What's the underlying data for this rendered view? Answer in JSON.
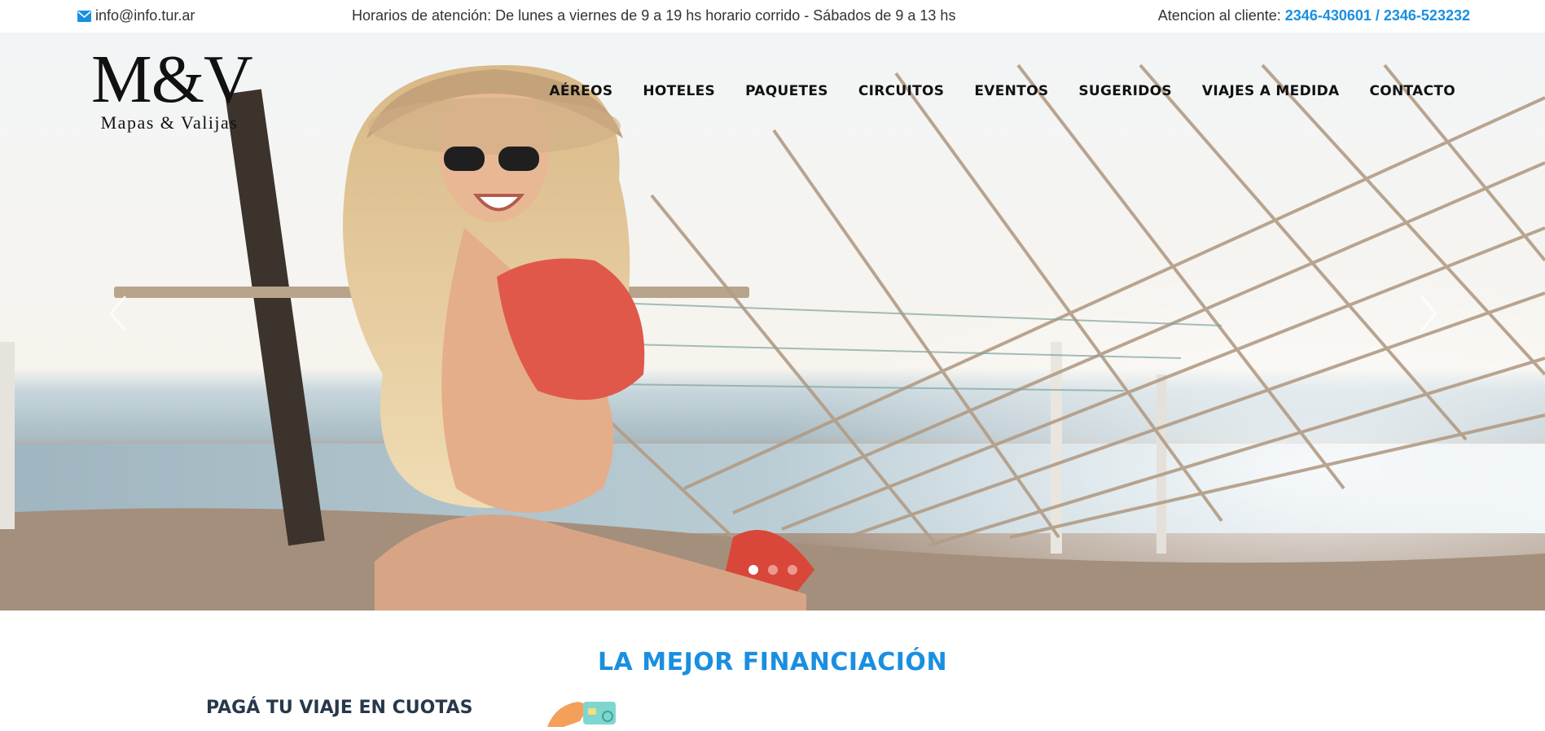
{
  "topbar": {
    "email": "info@info.tur.ar",
    "email_icon": "envelope-icon",
    "hours": "Horarios de atención: De lunes a viernes de 9 a 19 hs horario corrido - Sábados de 9 a 13 hs",
    "contact_label": "Atencion al cliente: ",
    "phones": "2346-430601 / 2346-523232"
  },
  "logo": {
    "mark": "M&V",
    "subtitle": "Mapas & Valijas"
  },
  "nav": {
    "items": [
      "AÉREOS",
      "HOTELES",
      "PAQUETES",
      "CIRCUITOS",
      "EVENTOS",
      "SUGERIDOS",
      "VIAJES A MEDIDA",
      "CONTACTO"
    ]
  },
  "carousel": {
    "prev_icon": "chevron-left-icon",
    "next_icon": "chevron-right-icon",
    "slide_count": 3,
    "active_slide": 1
  },
  "financing": {
    "title": "LA MEJOR FINANCIACIÓN",
    "subtitle": "PAGÁ TU VIAJE EN CUOTAS",
    "subtitle2": "",
    "icon": "credit-card-hand-icon"
  },
  "colors": {
    "accent": "#1a8fe0",
    "heading_dark": "#27384a",
    "nav_text": "#111111"
  }
}
